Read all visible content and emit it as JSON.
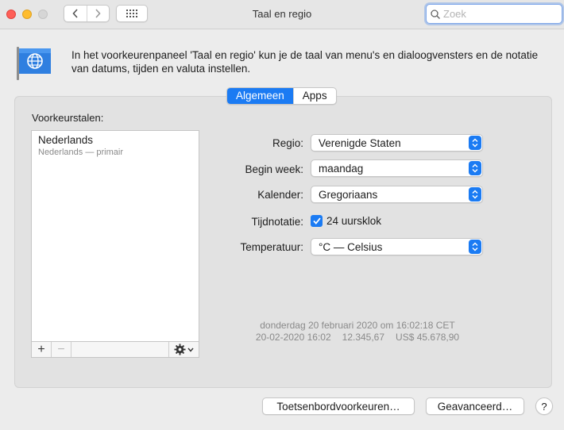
{
  "window": {
    "title": "Taal en regio"
  },
  "search": {
    "placeholder": "Zoek"
  },
  "intro": {
    "text": "In het voorkeurenpaneel 'Taal en regio' kun je de taal van menu's en dialoogvensters en de notatie van datums, tijden en valuta instellen."
  },
  "tabs": [
    {
      "label": "Algemeen",
      "active": true
    },
    {
      "label": "Apps",
      "active": false
    }
  ],
  "languages": {
    "label": "Voorkeurstalen:",
    "items": [
      {
        "name": "Nederlands",
        "sub": "Nederlands — primair"
      }
    ]
  },
  "list_toolbar": {
    "add": "+",
    "remove": "−"
  },
  "form": {
    "region": {
      "label": "Regio:",
      "value": "Verenigde Staten"
    },
    "first_day": {
      "label": "Begin week:",
      "value": "maandag"
    },
    "calendar": {
      "label": "Kalender:",
      "value": "Gregoriaans"
    },
    "time_format": {
      "label": "Tijdnotatie:",
      "checkbox_label": "24 uursklok",
      "checked": true
    },
    "temperature": {
      "label": "Temperatuur:",
      "value": "°C — Celsius"
    }
  },
  "sample": {
    "line1": "donderdag 20 februari 2020 om 16:02:18 CET",
    "date_short": "20-02-2020 16:02",
    "number": "12.345,67",
    "currency": "US$ 45.678,90"
  },
  "buttons": {
    "keyboard": "Toetsenbordvoorkeuren…",
    "advanced": "Geavanceerd…",
    "help": "?"
  },
  "colors": {
    "accent": "#1b7bf3",
    "close": "#fe5f57",
    "minimize": "#febc2e"
  }
}
